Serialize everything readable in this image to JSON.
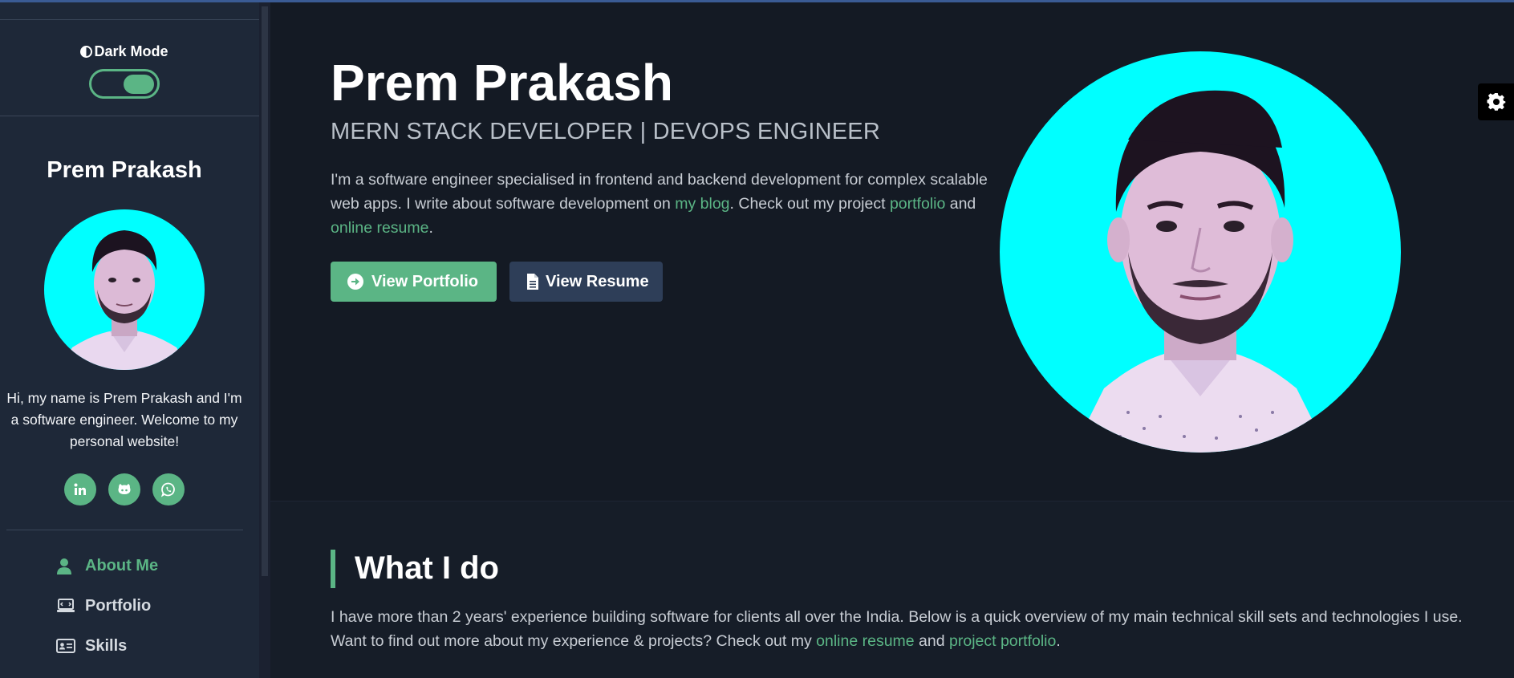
{
  "sidebar": {
    "dark_mode_label": "Dark Mode",
    "dark_mode_on": true,
    "name": "Prem Prakash",
    "intro": "Hi, my name is Prem Prakash and I'm a software engineer. Welcome to my personal website!",
    "social": [
      "linkedin-icon",
      "github-icon",
      "whatsapp-icon"
    ],
    "nav": [
      {
        "label": "About Me",
        "icon": "user-icon",
        "active": true
      },
      {
        "label": "Portfolio",
        "icon": "laptop-icon",
        "active": false
      },
      {
        "label": "Skills",
        "icon": "id-card-icon",
        "active": false
      }
    ]
  },
  "hero": {
    "name": "Prem Prakash",
    "tagline": "MERN STACK DEVELOPER | DEVOPS ENGINEER",
    "desc_part1": "I'm a software engineer specialised in frontend and backend development for complex scalable web apps. I write about software development on ",
    "link_blog": "my blog",
    "desc_part2": ". Check out my project ",
    "link_portfolio": "portfolio",
    "desc_part3": " and ",
    "link_resume": "online resume",
    "desc_part4": ".",
    "btn_portfolio": "View Portfolio",
    "btn_resume": "View Resume"
  },
  "whatido": {
    "title": "What I do",
    "desc_part1": "I have more than 2 years' experience building software for clients all over the India. Below is a quick overview of my main technical skill sets and technologies I use. Want to find out more about my experience & projects? Check out my ",
    "link_resume": "online resume",
    "desc_part2": " and ",
    "link_portfolio": "project portfolio",
    "desc_part3": "."
  },
  "colors": {
    "accent": "#5bb585",
    "sidebar_bg": "#1e2838",
    "main_bg": "#141a24",
    "button_secondary": "#2e3e58",
    "avatar_bg": "#00ffff"
  }
}
